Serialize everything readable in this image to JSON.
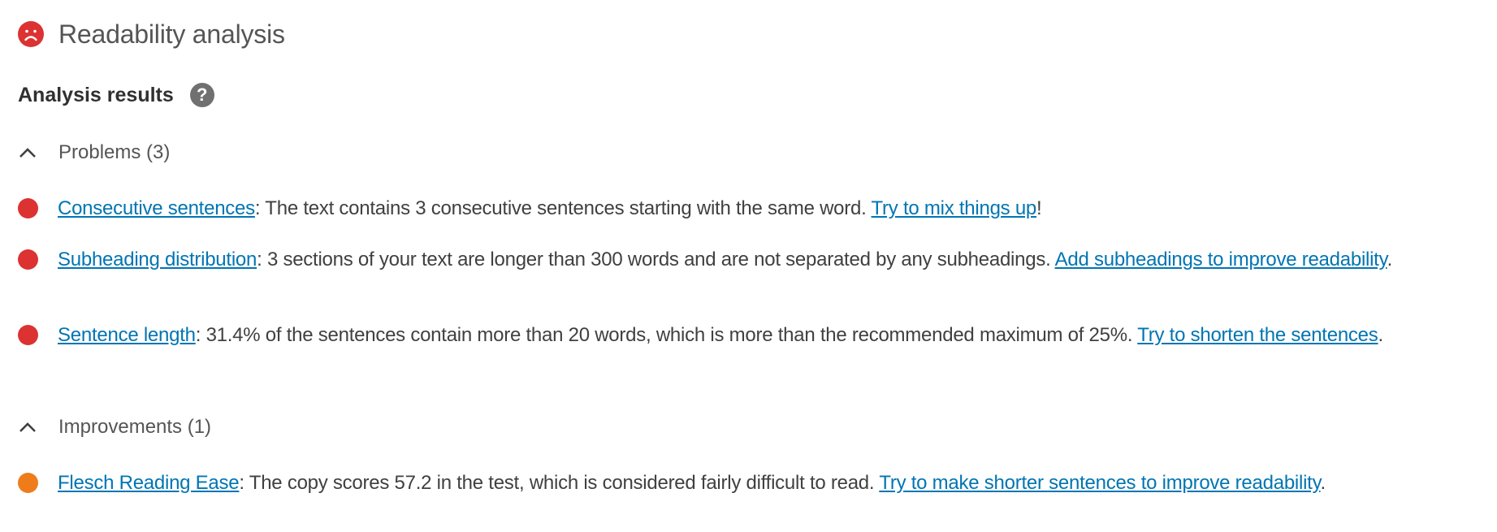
{
  "header": {
    "title": "Readability analysis",
    "status_icon": "sad-face-icon",
    "status_color": "#dc3232"
  },
  "analysis": {
    "title": "Analysis results",
    "help_icon": "question-mark-icon",
    "help_glyph": "?"
  },
  "colors": {
    "problem": "#dc3232",
    "improvement": "#ee7c1b",
    "link": "#0075b3",
    "text": "#404040"
  },
  "sections": [
    {
      "label": "Problems (3)",
      "expanded": true,
      "items": [
        {
          "status": "problem",
          "link_label": "Consecutive sentences",
          "text": ": The text contains 3 consecutive sentences starting with the same word. ",
          "action_label": "Try to mix things up",
          "suffix": "!"
        },
        {
          "status": "problem",
          "link_label": "Subheading distribution",
          "text": ": 3 sections of your text are longer than 300 words and are not separated by any subheadings. ",
          "action_label": "Add subheadings to improve readability",
          "suffix": "."
        },
        {
          "status": "problem",
          "link_label": "Sentence length",
          "text": ": 31.4% of the sentences contain more than 20 words, which is more than the recommended maximum of 25%. ",
          "action_label": "Try to shorten the sentences",
          "suffix": "."
        }
      ]
    },
    {
      "label": "Improvements (1)",
      "expanded": true,
      "items": [
        {
          "status": "improvement",
          "link_label": "Flesch Reading Ease",
          "text": ": The copy scores 57.2 in the test, which is considered fairly difficult to read. ",
          "action_label": "Try to make shorter sentences to improve readability",
          "suffix": "."
        }
      ]
    }
  ]
}
